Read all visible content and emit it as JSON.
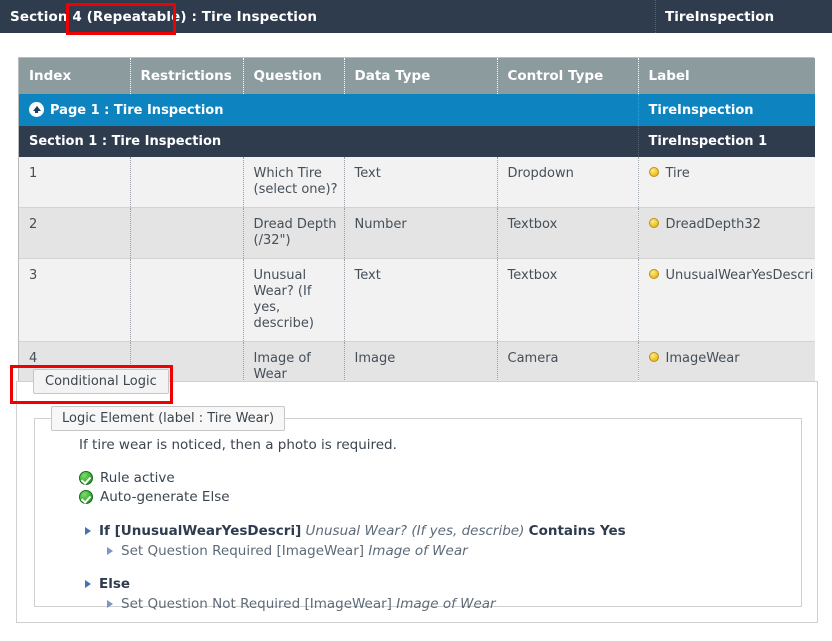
{
  "header": {
    "title_prefix": "Section 4 ",
    "title_repeatable": "(Repeatable)",
    "title_suffix": " : Tire Inspection",
    "right_label": "TireInspection"
  },
  "table": {
    "columns": [
      "Index",
      "Restrictions",
      "Question",
      "Data Type",
      "Control Type",
      "Label"
    ],
    "page_row": {
      "title": "Page 1 : Tire Inspection",
      "label": "TireInspection",
      "icon": "page-up-icon"
    },
    "section_row": {
      "title": "Section 1 : Tire Inspection",
      "label": "TireInspection 1"
    },
    "rows": [
      {
        "index": "1",
        "restrictions": "",
        "question": "Which Tire (select one)?",
        "data_type": "Text",
        "control_type": "Dropdown",
        "label": "Tire"
      },
      {
        "index": "2",
        "restrictions": "",
        "question": "Dread Depth (/32\")",
        "data_type": "Number",
        "control_type": "Textbox",
        "label": "DreadDepth32"
      },
      {
        "index": "3",
        "restrictions": "",
        "question": "Unusual Wear? (If yes, describe)",
        "data_type": "Text",
        "control_type": "Textbox",
        "label": "UnusualWearYesDescri"
      },
      {
        "index": "4",
        "restrictions": "",
        "question": "Image of Wear",
        "data_type": "Image",
        "control_type": "Camera",
        "label": "ImageWear"
      }
    ]
  },
  "conditional_logic": {
    "legend": "Conditional Logic",
    "logic_element_legend": "Logic Element (label : Tire Wear)",
    "description": "If tire wear is noticed, then a photo is required.",
    "flags": [
      {
        "label": "Rule active",
        "icon": "green-check-icon"
      },
      {
        "label": "Auto-generate Else",
        "icon": "green-check-icon"
      }
    ],
    "if_branch": {
      "keyword": "If [UnusualWearYesDescri]",
      "question": "Unusual Wear? (If yes, describe)",
      "operator": "Contains Yes",
      "action_prefix": "Set Question Required [ImageWear]",
      "action_question": "Image of Wear"
    },
    "else_branch": {
      "keyword": "Else",
      "action_prefix": "Set Question Not Required [ImageWear]",
      "action_question": "Image of Wear"
    }
  },
  "colors": {
    "header_bg": "#2e3c4e",
    "table_header_bg": "#8c9b9e",
    "page_row_bg": "#0d84c0",
    "section_row_bg": "#2e3c4e",
    "annotation": "#f00000",
    "bullet": "#f0c92e",
    "check": "#35ac2e"
  }
}
